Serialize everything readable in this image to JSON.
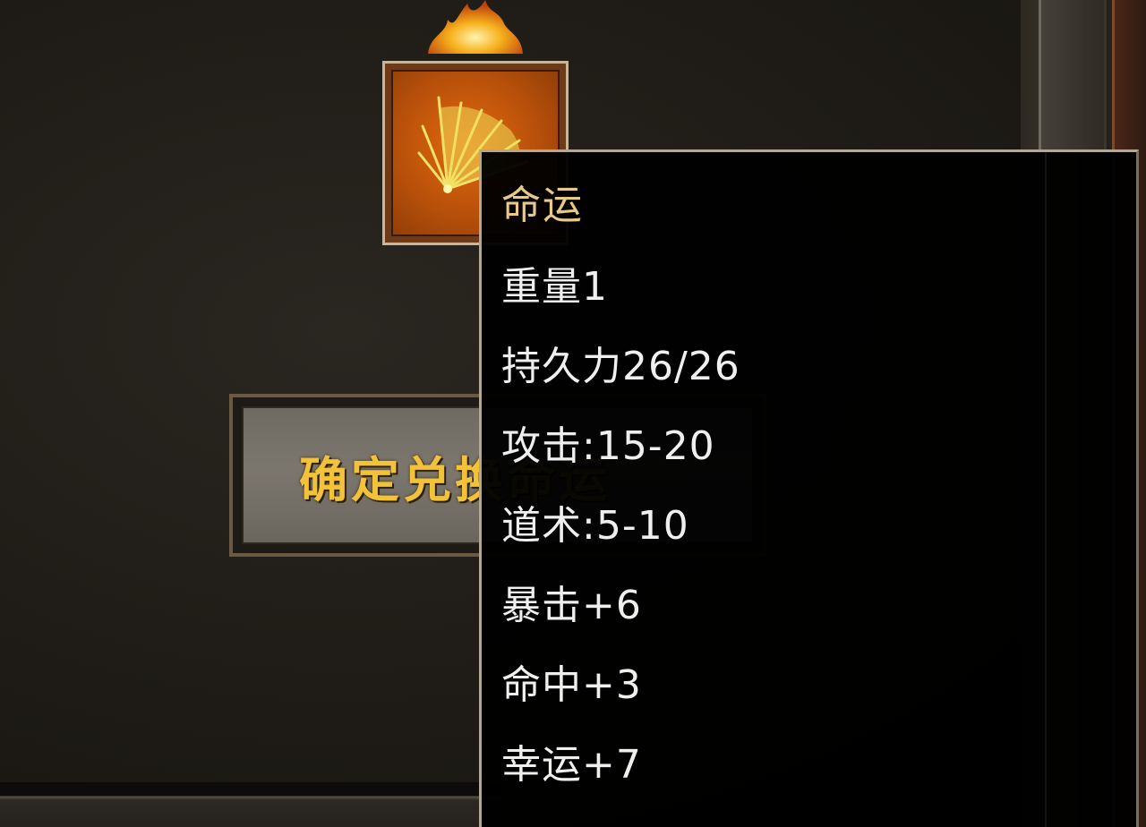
{
  "item": {
    "name": "命运",
    "icon": "golden-fan-icon"
  },
  "tooltip": {
    "title": "命运",
    "stats": [
      "重量1",
      "持久力26/26",
      "攻击:15-20",
      "道术:5-10",
      "暴击+6",
      "命中+3",
      "幸运+7"
    ]
  },
  "confirm_button": {
    "label": "确定兑换命运"
  },
  "colors": {
    "title": "#e7c98a",
    "stat_text": "#efefef",
    "button_text": "#f2c33a",
    "slot_fill": "#e46a0e"
  }
}
